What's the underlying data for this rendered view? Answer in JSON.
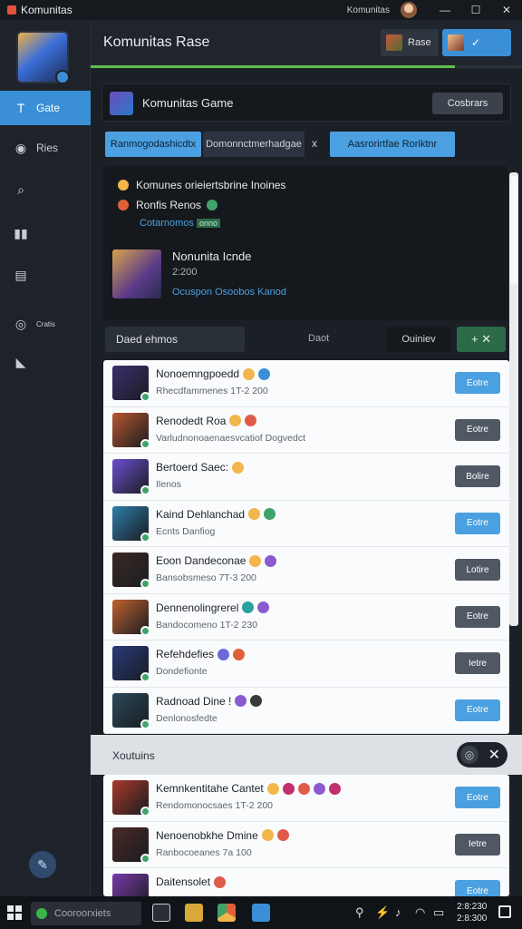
{
  "window": {
    "title": "Komunitas",
    "user": "Komunitas",
    "minimize": "—",
    "maximize": "☐",
    "close": "✕"
  },
  "sidebar": {
    "items": [
      {
        "label": "Gate",
        "icon": "T"
      },
      {
        "label": "Ries",
        "icon": "◉"
      },
      {
        "label": "",
        "icon": "⌕"
      },
      {
        "label": "",
        "icon": "▮▮"
      },
      {
        "label": "",
        "icon": "▤"
      },
      {
        "label": "Cratis",
        "icon": "◎"
      },
      {
        "label": "",
        "icon": "◣"
      }
    ],
    "bottom_icon": "✎"
  },
  "header": {
    "title": "Komunitas Rase",
    "btn1_label": "Rase",
    "btn2_label": "✓",
    "progress_fraction": 0.845
  },
  "game_card": {
    "name": "Komunitas Game",
    "button_label": "Cosbrars"
  },
  "tabs": [
    {
      "label": "Ranmogodashicdtx"
    },
    {
      "label": "Domonnctmerhadgae"
    },
    {
      "label": "Aasrorirtfae Roriktnr"
    }
  ],
  "tab_separator": "x",
  "info": {
    "line1": "Komunes orieiertsbrine Inoines",
    "line2": "Ronfis Renos",
    "line3": "Cotarnomos",
    "line3_badge": "onno",
    "title": "Nonunita Icnde",
    "subtitle": "2:200",
    "link": "Ocuspon Osoobos Kanod"
  },
  "filter": {
    "label": "Daed ehmos",
    "mid": "Daot",
    "button": "Ouiniev",
    "add": "+  ✕"
  },
  "list1": [
    {
      "name": "Nonoemngpoedd",
      "sub": "Rhecdfammenes 1T-2 200",
      "action": "Eotre",
      "style": "blue",
      "thumb": "#3a2f6b",
      "emojis": [
        "#f2b64a",
        "#3a8fd6"
      ]
    },
    {
      "name": "Renodedt Roa",
      "sub": "Varludnonoaenaesvcatiof Dogvedct",
      "action": "Eotre",
      "style": "dark",
      "thumb": "#b8572e",
      "emojis": [
        "#f2b64a",
        "#e05a4a"
      ]
    },
    {
      "name": "Bertoerd Saec:",
      "sub": "Ilenos",
      "action": "Bolire",
      "style": "dark",
      "thumb": "#6b4fd0",
      "emojis": [
        "#f2b64a"
      ]
    },
    {
      "name": "Kaind Dehlanchad",
      "sub": "Ecnts Danfiog",
      "action": "Eotre",
      "style": "blue",
      "thumb": "#2d7ea8",
      "emojis": [
        "#f2b64a",
        "#3fa36a"
      ]
    },
    {
      "name": "Eoon Dandeconae",
      "sub": "Bansobsmeso 7T-3 200",
      "action": "Lotire",
      "style": "dark",
      "thumb": "#3a2a24",
      "emojis": [
        "#f2b64a",
        "#8a5ad0"
      ]
    },
    {
      "name": "Dennenolingrerel",
      "sub": "Bandocomeno 1T-2 230",
      "action": "Eotre",
      "style": "dark",
      "thumb": "#c0622e",
      "emojis": [
        "#2aa0a0",
        "#8a5ad0"
      ]
    },
    {
      "name": "Refehdefies",
      "sub": "Dondefionte",
      "action": "Ietre",
      "style": "dark",
      "thumb": "#2a3a7a",
      "emojis": [
        "#6a6ad8",
        "#e0603a"
      ]
    },
    {
      "name": "Radnoad Dine !",
      "sub": "Denlonosfedte",
      "action": "Eotre",
      "style": "blue",
      "thumb": "#2a4a5a",
      "emojis": [
        "#8a5ad0",
        "#3a3a3a"
      ]
    }
  ],
  "section": {
    "title": "Xoutuins",
    "toggle_icon": "◎",
    "close_icon": "✕"
  },
  "list2": [
    {
      "name": "Kemnkentitahe Cantet",
      "sub": "Rendomonocsaes 1T-2 200",
      "action": "Eotre",
      "style": "blue",
      "thumb": "#a83a2a",
      "emojis": [
        "#f2b64a",
        "#c0306a",
        "#e05a4a",
        "#8a5ad0",
        "#c0306a"
      ]
    },
    {
      "name": "Nenoenobkhe Dmine",
      "sub": "Ranbocoeanes 7a 100",
      "action": "Ietre",
      "style": "dark",
      "thumb": "#4a2a24",
      "emojis": [
        "#f2b64a",
        "#e05a4a"
      ]
    },
    {
      "name": "Daitensolet",
      "sub": "",
      "action": "Eotre",
      "style": "blue",
      "thumb": "#7a3aa8",
      "emojis": [
        "#e05a4a"
      ]
    }
  ],
  "taskbar": {
    "search": "Cooroorxiets",
    "time": "2:8:230",
    "date": "2:8:300"
  }
}
